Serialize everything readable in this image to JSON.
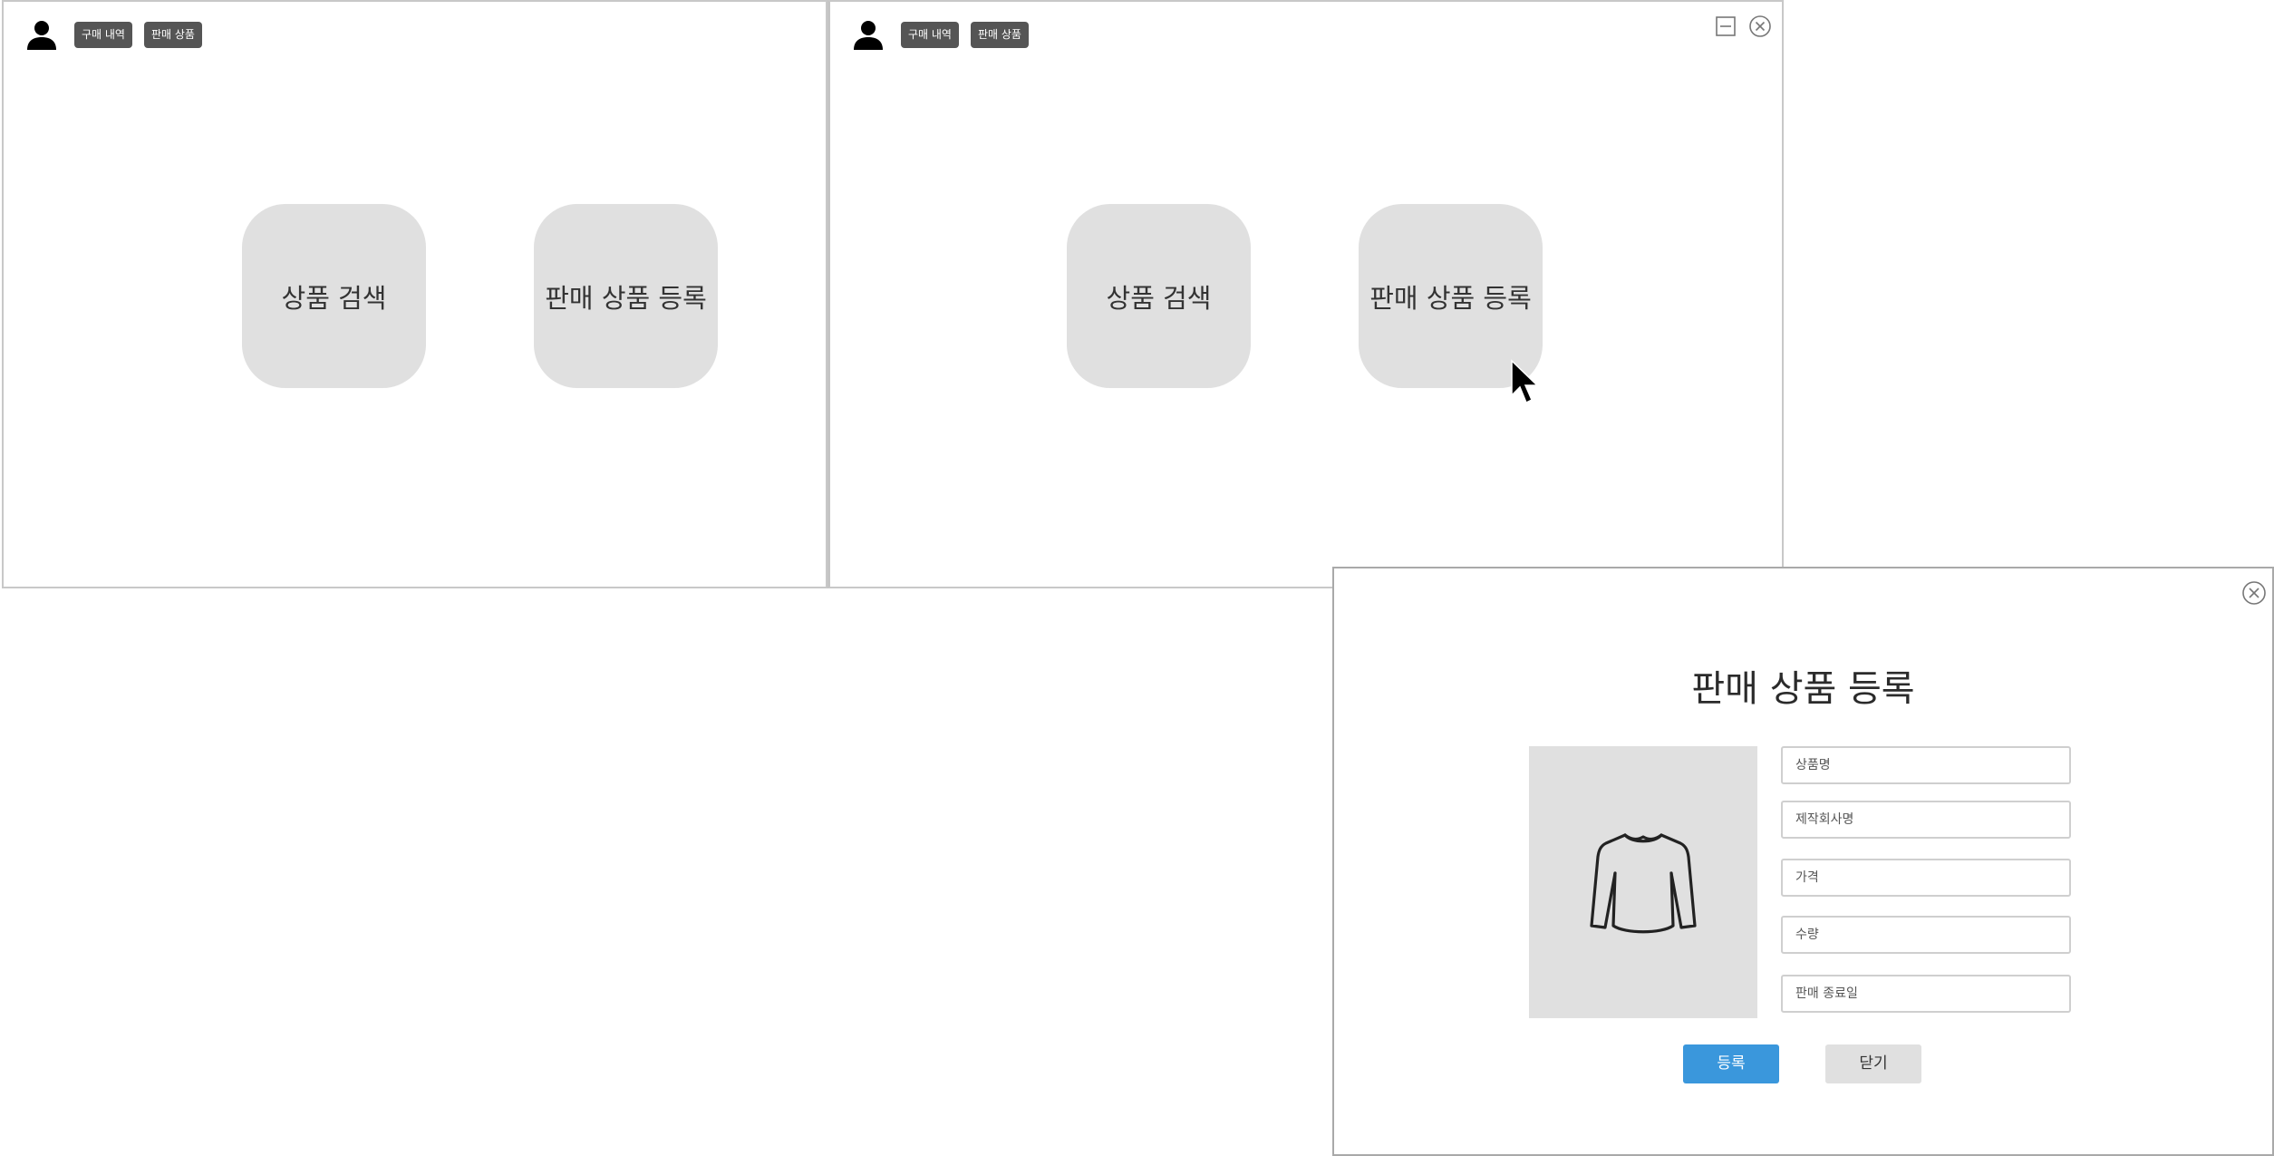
{
  "screen1": {
    "tabs": [
      "구매 내역",
      "판매 상품"
    ],
    "buttons": [
      "상품 검색",
      "판매 상품 등록"
    ]
  },
  "screen2": {
    "tabs": [
      "구매 내역",
      "판매 상품"
    ],
    "buttons": [
      "상품 검색",
      "판매 상품 등록"
    ],
    "window_controls": [
      "minimize-icon",
      "close-icon"
    ]
  },
  "dialog": {
    "title": "판매 상품 등록",
    "image_icon": "sweater-icon",
    "fields": [
      {
        "placeholder": "상품명",
        "value": ""
      },
      {
        "placeholder": "제작회사명",
        "value": ""
      },
      {
        "placeholder": "가격",
        "value": ""
      },
      {
        "placeholder": "수량",
        "value": ""
      },
      {
        "placeholder": "판매 종료일",
        "value": ""
      }
    ],
    "register_label": "등록",
    "close_label": "닫기"
  },
  "colors": {
    "tag_bg": "#555555",
    "button_bg": "#e0e0e0",
    "primary": "#3a97dc"
  }
}
